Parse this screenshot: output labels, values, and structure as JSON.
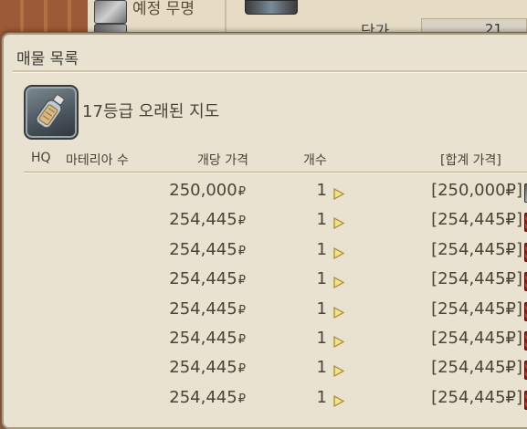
{
  "background": {
    "item_text": "예정 무명",
    "label": "단가",
    "value": "21"
  },
  "window": {
    "title": "매물 목록",
    "item": {
      "name": "17등급 오래된 지도",
      "icon": "bottle-map-icon"
    },
    "columns": {
      "hq": "HQ",
      "materia": "마테리아 수",
      "unit_price": "개당 가격",
      "quantity": "개수",
      "total": "[합계 가격]"
    },
    "currency_symbol": "₽",
    "rows": [
      {
        "unit_price": "250,000",
        "quantity": "1",
        "total": "[250,000₽]",
        "icon": "gray"
      },
      {
        "unit_price": "254,445",
        "quantity": "1",
        "total": "[254,445₽]",
        "icon": "red"
      },
      {
        "unit_price": "254,445",
        "quantity": "1",
        "total": "[254,445₽]",
        "icon": "red"
      },
      {
        "unit_price": "254,445",
        "quantity": "1",
        "total": "[254,445₽]",
        "icon": "red"
      },
      {
        "unit_price": "254,445",
        "quantity": "1",
        "total": "[254,445₽]",
        "icon": "red"
      },
      {
        "unit_price": "254,445",
        "quantity": "1",
        "total": "[254,445₽]",
        "icon": "red"
      },
      {
        "unit_price": "254,445",
        "quantity": "1",
        "total": "[254,445₽]",
        "icon": "red"
      },
      {
        "unit_price": "254,445",
        "quantity": "1",
        "total": "[254,445₽]",
        "icon": "red"
      }
    ]
  }
}
